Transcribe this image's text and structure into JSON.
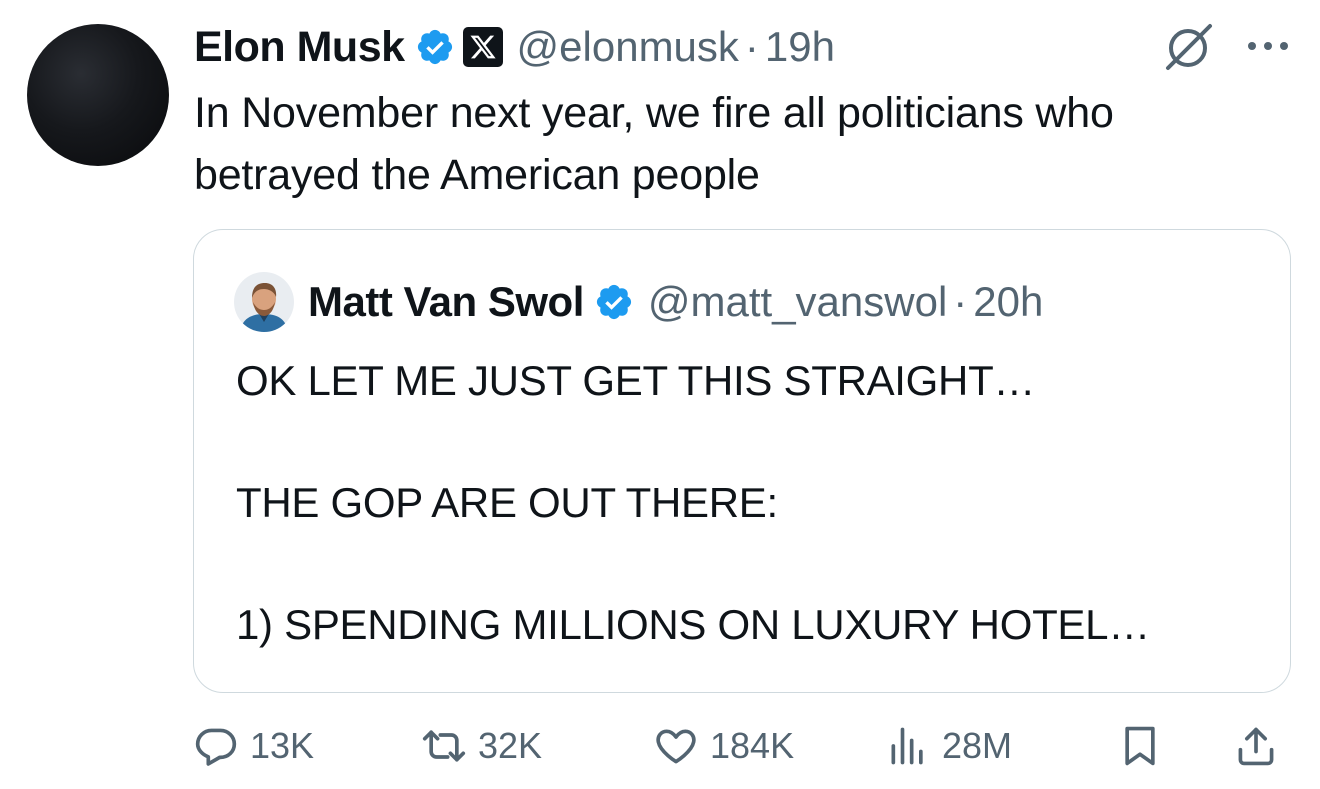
{
  "tweet": {
    "author": {
      "name": "Elon Musk",
      "handle": "@elonmusk",
      "time": "19h",
      "verified": true,
      "affiliation_badge": "x-logo-icon"
    },
    "separator": "·",
    "text": "In November next year, we fire all politicians who betrayed the American people",
    "quoted": {
      "author": {
        "name": "Matt Van Swol",
        "handle": "@matt_vanswol",
        "time": "20h",
        "verified": true
      },
      "lines": [
        "OK LET ME JUST GET THIS STRAIGHT…",
        "",
        "THE GOP ARE OUT THERE:",
        "",
        "1) SPENDING MILLIONS ON LUXURY HOTEL…"
      ]
    },
    "actions": {
      "replies": "13K",
      "reposts": "32K",
      "likes": "184K",
      "views": "28M"
    },
    "colors": {
      "verified_blue": "#1d9bf0",
      "secondary_text": "#536471",
      "border": "#cfd9de"
    }
  }
}
